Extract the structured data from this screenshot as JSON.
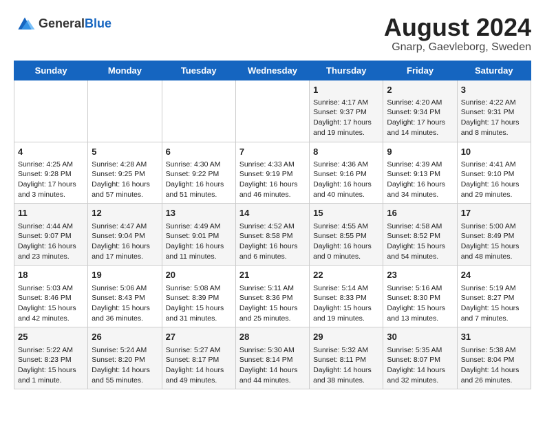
{
  "header": {
    "logo_general": "General",
    "logo_blue": "Blue",
    "main_title": "August 2024",
    "subtitle": "Gnarp, Gaevleborg, Sweden"
  },
  "weekdays": [
    "Sunday",
    "Monday",
    "Tuesday",
    "Wednesday",
    "Thursday",
    "Friday",
    "Saturday"
  ],
  "weeks": [
    [
      {
        "day": "",
        "sunrise": "",
        "sunset": "",
        "daylight": ""
      },
      {
        "day": "",
        "sunrise": "",
        "sunset": "",
        "daylight": ""
      },
      {
        "day": "",
        "sunrise": "",
        "sunset": "",
        "daylight": ""
      },
      {
        "day": "",
        "sunrise": "",
        "sunset": "",
        "daylight": ""
      },
      {
        "day": "1",
        "sunrise": "Sunrise: 4:17 AM",
        "sunset": "Sunset: 9:37 PM",
        "daylight": "Daylight: 17 hours and 19 minutes."
      },
      {
        "day": "2",
        "sunrise": "Sunrise: 4:20 AM",
        "sunset": "Sunset: 9:34 PM",
        "daylight": "Daylight: 17 hours and 14 minutes."
      },
      {
        "day": "3",
        "sunrise": "Sunrise: 4:22 AM",
        "sunset": "Sunset: 9:31 PM",
        "daylight": "Daylight: 17 hours and 8 minutes."
      }
    ],
    [
      {
        "day": "4",
        "sunrise": "Sunrise: 4:25 AM",
        "sunset": "Sunset: 9:28 PM",
        "daylight": "Daylight: 17 hours and 3 minutes."
      },
      {
        "day": "5",
        "sunrise": "Sunrise: 4:28 AM",
        "sunset": "Sunset: 9:25 PM",
        "daylight": "Daylight: 16 hours and 57 minutes."
      },
      {
        "day": "6",
        "sunrise": "Sunrise: 4:30 AM",
        "sunset": "Sunset: 9:22 PM",
        "daylight": "Daylight: 16 hours and 51 minutes."
      },
      {
        "day": "7",
        "sunrise": "Sunrise: 4:33 AM",
        "sunset": "Sunset: 9:19 PM",
        "daylight": "Daylight: 16 hours and 46 minutes."
      },
      {
        "day": "8",
        "sunrise": "Sunrise: 4:36 AM",
        "sunset": "Sunset: 9:16 PM",
        "daylight": "Daylight: 16 hours and 40 minutes."
      },
      {
        "day": "9",
        "sunrise": "Sunrise: 4:39 AM",
        "sunset": "Sunset: 9:13 PM",
        "daylight": "Daylight: 16 hours and 34 minutes."
      },
      {
        "day": "10",
        "sunrise": "Sunrise: 4:41 AM",
        "sunset": "Sunset: 9:10 PM",
        "daylight": "Daylight: 16 hours and 29 minutes."
      }
    ],
    [
      {
        "day": "11",
        "sunrise": "Sunrise: 4:44 AM",
        "sunset": "Sunset: 9:07 PM",
        "daylight": "Daylight: 16 hours and 23 minutes."
      },
      {
        "day": "12",
        "sunrise": "Sunrise: 4:47 AM",
        "sunset": "Sunset: 9:04 PM",
        "daylight": "Daylight: 16 hours and 17 minutes."
      },
      {
        "day": "13",
        "sunrise": "Sunrise: 4:49 AM",
        "sunset": "Sunset: 9:01 PM",
        "daylight": "Daylight: 16 hours and 11 minutes."
      },
      {
        "day": "14",
        "sunrise": "Sunrise: 4:52 AM",
        "sunset": "Sunset: 8:58 PM",
        "daylight": "Daylight: 16 hours and 6 minutes."
      },
      {
        "day": "15",
        "sunrise": "Sunrise: 4:55 AM",
        "sunset": "Sunset: 8:55 PM",
        "daylight": "Daylight: 16 hours and 0 minutes."
      },
      {
        "day": "16",
        "sunrise": "Sunrise: 4:58 AM",
        "sunset": "Sunset: 8:52 PM",
        "daylight": "Daylight: 15 hours and 54 minutes."
      },
      {
        "day": "17",
        "sunrise": "Sunrise: 5:00 AM",
        "sunset": "Sunset: 8:49 PM",
        "daylight": "Daylight: 15 hours and 48 minutes."
      }
    ],
    [
      {
        "day": "18",
        "sunrise": "Sunrise: 5:03 AM",
        "sunset": "Sunset: 8:46 PM",
        "daylight": "Daylight: 15 hours and 42 minutes."
      },
      {
        "day": "19",
        "sunrise": "Sunrise: 5:06 AM",
        "sunset": "Sunset: 8:43 PM",
        "daylight": "Daylight: 15 hours and 36 minutes."
      },
      {
        "day": "20",
        "sunrise": "Sunrise: 5:08 AM",
        "sunset": "Sunset: 8:39 PM",
        "daylight": "Daylight: 15 hours and 31 minutes."
      },
      {
        "day": "21",
        "sunrise": "Sunrise: 5:11 AM",
        "sunset": "Sunset: 8:36 PM",
        "daylight": "Daylight: 15 hours and 25 minutes."
      },
      {
        "day": "22",
        "sunrise": "Sunrise: 5:14 AM",
        "sunset": "Sunset: 8:33 PM",
        "daylight": "Daylight: 15 hours and 19 minutes."
      },
      {
        "day": "23",
        "sunrise": "Sunrise: 5:16 AM",
        "sunset": "Sunset: 8:30 PM",
        "daylight": "Daylight: 15 hours and 13 minutes."
      },
      {
        "day": "24",
        "sunrise": "Sunrise: 5:19 AM",
        "sunset": "Sunset: 8:27 PM",
        "daylight": "Daylight: 15 hours and 7 minutes."
      }
    ],
    [
      {
        "day": "25",
        "sunrise": "Sunrise: 5:22 AM",
        "sunset": "Sunset: 8:23 PM",
        "daylight": "Daylight: 15 hours and 1 minute."
      },
      {
        "day": "26",
        "sunrise": "Sunrise: 5:24 AM",
        "sunset": "Sunset: 8:20 PM",
        "daylight": "Daylight: 14 hours and 55 minutes."
      },
      {
        "day": "27",
        "sunrise": "Sunrise: 5:27 AM",
        "sunset": "Sunset: 8:17 PM",
        "daylight": "Daylight: 14 hours and 49 minutes."
      },
      {
        "day": "28",
        "sunrise": "Sunrise: 5:30 AM",
        "sunset": "Sunset: 8:14 PM",
        "daylight": "Daylight: 14 hours and 44 minutes."
      },
      {
        "day": "29",
        "sunrise": "Sunrise: 5:32 AM",
        "sunset": "Sunset: 8:11 PM",
        "daylight": "Daylight: 14 hours and 38 minutes."
      },
      {
        "day": "30",
        "sunrise": "Sunrise: 5:35 AM",
        "sunset": "Sunset: 8:07 PM",
        "daylight": "Daylight: 14 hours and 32 minutes."
      },
      {
        "day": "31",
        "sunrise": "Sunrise: 5:38 AM",
        "sunset": "Sunset: 8:04 PM",
        "daylight": "Daylight: 14 hours and 26 minutes."
      }
    ]
  ]
}
